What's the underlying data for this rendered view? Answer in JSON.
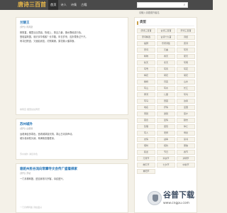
{
  "header": {
    "logo_text": "唐诗三百首",
    "nav": [
      "首页",
      "诗人",
      "诗集",
      "古籍"
    ],
    "search_placeholder": "请输入诗题或作者名"
  },
  "posts": [
    {
      "title": "兰陵王",
      "meta": "[宋代] 周邦彦",
      "lines": [
        "柳阴直，烟里丝丝弄碧。隋堤上、曾见几番，拂水飘绵送行色。",
        "登临望故国，谁识京华倦客？长亭路，年去岁来，应折柔条过千尺。",
        "闲寻旧踪迹，又酒趁哀弦，灯照离席。梨花榆火催寒食。"
      ],
      "foot": "柳阴直 烟里丝丝弄碧"
    },
    {
      "title": "苏州城外",
      "meta": "[唐代] 白居易",
      "lines": [
        "远看满目多寒色，宫墙城郭接天阴。寒山古寺钟声动。",
        "城头老树枝头绿，草满故宫春更深。"
      ],
      "foot": "苏州城外 满目寒色"
    },
    {
      "title": "骆驼州民谷流向常摩寺文会传广盛着棋家",
      "meta": "[宋代] 苏轼",
      "lines": [
        "一门月樽转殷，盛自家收与宗客，诗纹盛兴。"
      ],
      "foot": "一门月樽转殷 诗纹盛兴"
    }
  ],
  "sidebar": {
    "title": "类型",
    "tags": [
      "唐诗三百首",
      "古诗三百首",
      "宋词三百首",
      "宋词精选",
      "古诗十九首",
      "诗经",
      "楚辞",
      "乐府诗集",
      "唐诗",
      "宋词",
      "元曲",
      "写景",
      "咏物",
      "春天",
      "夏天",
      "秋天",
      "冬天",
      "写雨",
      "写雪",
      "写风",
      "写花",
      "梅花",
      "荷花",
      "菊花",
      "柳树",
      "月亮",
      "山水",
      "写山",
      "写水",
      "长江",
      "黄河",
      "儿童",
      "写鸟",
      "写马",
      "田园",
      "边塞",
      "地名",
      "抒情",
      "爱国",
      "离别",
      "送别",
      "思乡",
      "思念",
      "爱情",
      "励志",
      "哲理",
      "闺怨",
      "悼亡",
      "写人",
      "老师",
      "母亲",
      "友情",
      "战争",
      "读书",
      "惜时",
      "婉约",
      "豪放",
      "民谣",
      "节日",
      "春节",
      "元宵节",
      "寒食节",
      "清明节",
      "端午节",
      "七夕节",
      "中秋节",
      "重阳节"
    ]
  },
  "ad": {
    "name": "谷普下载",
    "url": "www.cngpu.com"
  }
}
